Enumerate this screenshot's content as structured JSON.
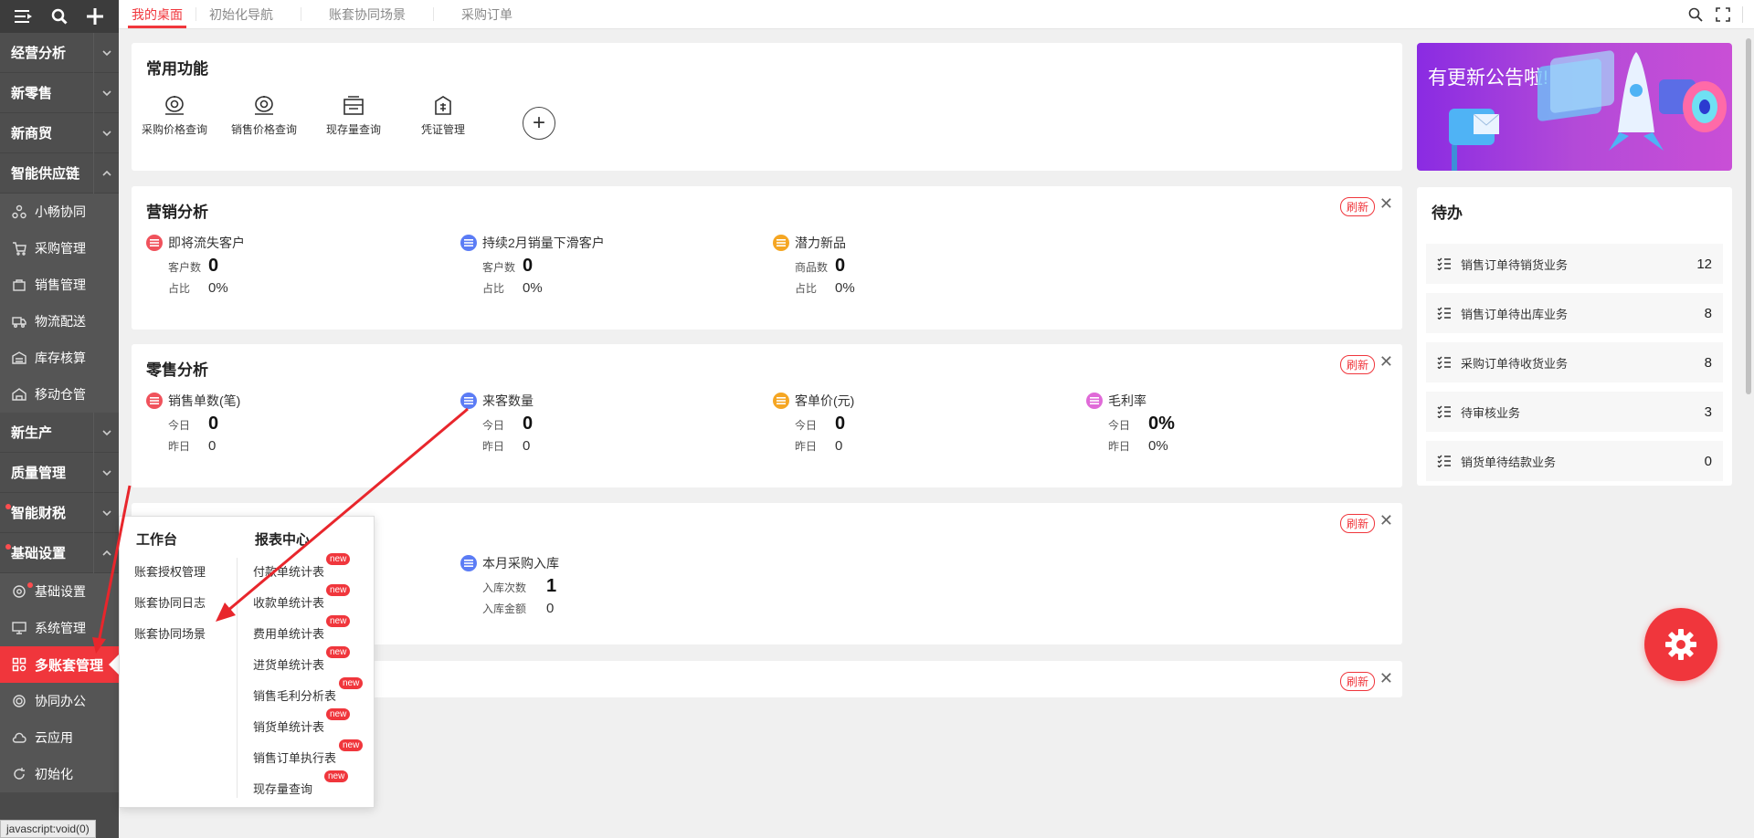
{
  "sidebar": {
    "sections": [
      {
        "label": "经营分析"
      },
      {
        "label": "新零售"
      },
      {
        "label": "新商贸"
      },
      {
        "label": "智能供应链"
      }
    ],
    "supply_items": [
      {
        "label": "小畅协同",
        "icon": "collab-icon"
      },
      {
        "label": "采购管理",
        "icon": "cart-icon"
      },
      {
        "label": "销售管理",
        "icon": "sales-icon"
      },
      {
        "label": "物流配送",
        "icon": "truck-icon"
      },
      {
        "label": "库存核算",
        "icon": "warehouse-icon"
      },
      {
        "label": "移动仓管",
        "icon": "mobile-warehouse-icon"
      }
    ],
    "sections2": [
      {
        "label": "新生产"
      },
      {
        "label": "质量管理"
      },
      {
        "label": "智能财税"
      },
      {
        "label": "基础设置"
      }
    ],
    "base_items": [
      {
        "label": "基础设置",
        "icon": "settings-icon"
      },
      {
        "label": "系统管理",
        "icon": "system-icon"
      },
      {
        "label": "多账套管理",
        "icon": "multi-account-icon"
      },
      {
        "label": "协同办公",
        "icon": "office-icon"
      },
      {
        "label": "云应用",
        "icon": "cloud-icon"
      },
      {
        "label": "初始化",
        "icon": "init-icon"
      }
    ]
  },
  "tabs": [
    {
      "label": "我的桌面"
    },
    {
      "label": "初始化导航"
    },
    {
      "label": "账套协同场景"
    },
    {
      "label": "采购订单"
    }
  ],
  "common": {
    "title": "常用功能",
    "items": [
      {
        "label": "采购价格查询",
        "icon": "purchase-price-icon"
      },
      {
        "label": "销售价格查询",
        "icon": "sales-price-icon"
      },
      {
        "label": "现存量查询",
        "icon": "stock-icon"
      },
      {
        "label": "凭证管理",
        "icon": "voucher-icon"
      }
    ]
  },
  "marketing": {
    "title": "营销分析",
    "refresh": "刷新",
    "metrics": [
      {
        "name": "即将流失客户",
        "k1": "客户数",
        "v1": "0",
        "k2": "占比",
        "v2": "0%",
        "color": "#f0525c"
      },
      {
        "name": "持续2月销量下滑客户",
        "k1": "客户数",
        "v1": "0",
        "k2": "占比",
        "v2": "0%",
        "color": "#5b7cf5"
      },
      {
        "name": "潜力新品",
        "k1": "商品数",
        "v1": "0",
        "k2": "占比",
        "v2": "0%",
        "color": "#f5a623"
      }
    ]
  },
  "retail": {
    "title": "零售分析",
    "refresh": "刷新",
    "metrics": [
      {
        "name": "销售单数(笔)",
        "k1": "今日",
        "v1": "0",
        "k2": "昨日",
        "v2": "0",
        "color": "#f0525c"
      },
      {
        "name": "来客数量",
        "k1": "今日",
        "v1": "0",
        "k2": "昨日",
        "v2": "0",
        "color": "#5b7cf5"
      },
      {
        "name": "客单价(元)",
        "k1": "今日",
        "v1": "0",
        "k2": "昨日",
        "v2": "0",
        "color": "#f5a623"
      },
      {
        "name": "毛利率",
        "k1": "今日",
        "v1": "0%",
        "k2": "昨日",
        "v2": "0%",
        "color": "#e06ad8"
      }
    ]
  },
  "purchase": {
    "refresh": "刷新",
    "metric": {
      "name": "本月采购入库",
      "k1": "入库次数",
      "v1": "1",
      "k2": "入库金额",
      "v2": "0",
      "color": "#5b7cf5"
    }
  },
  "card4": {
    "refresh": "刷新"
  },
  "banner": {
    "title": "有更新公告啦!"
  },
  "todo": {
    "title": "待办",
    "items": [
      {
        "label": "销售订单待销货业务",
        "count": "12"
      },
      {
        "label": "销售订单待出库业务",
        "count": "8"
      },
      {
        "label": "采购订单待收货业务",
        "count": "8"
      },
      {
        "label": "待审核业务",
        "count": "3"
      },
      {
        "label": "销货单待结款业务",
        "count": "0"
      }
    ]
  },
  "popup": {
    "left_title": "工作台",
    "right_title": "报表中心",
    "left_items": [
      "账套授权管理",
      "账套协同日志",
      "账套协同场景"
    ],
    "right_items": [
      "付款单统计表",
      "收款单统计表",
      "费用单统计表",
      "进货单统计表",
      "销售毛利分析表",
      "销货单统计表",
      "销售订单执行表",
      "现存量查询"
    ],
    "new_badge": "new"
  },
  "status_bar": "javascript:void(0)",
  "colors": {
    "accent": "#f0363c",
    "sidebar": "#4a4a4a"
  }
}
